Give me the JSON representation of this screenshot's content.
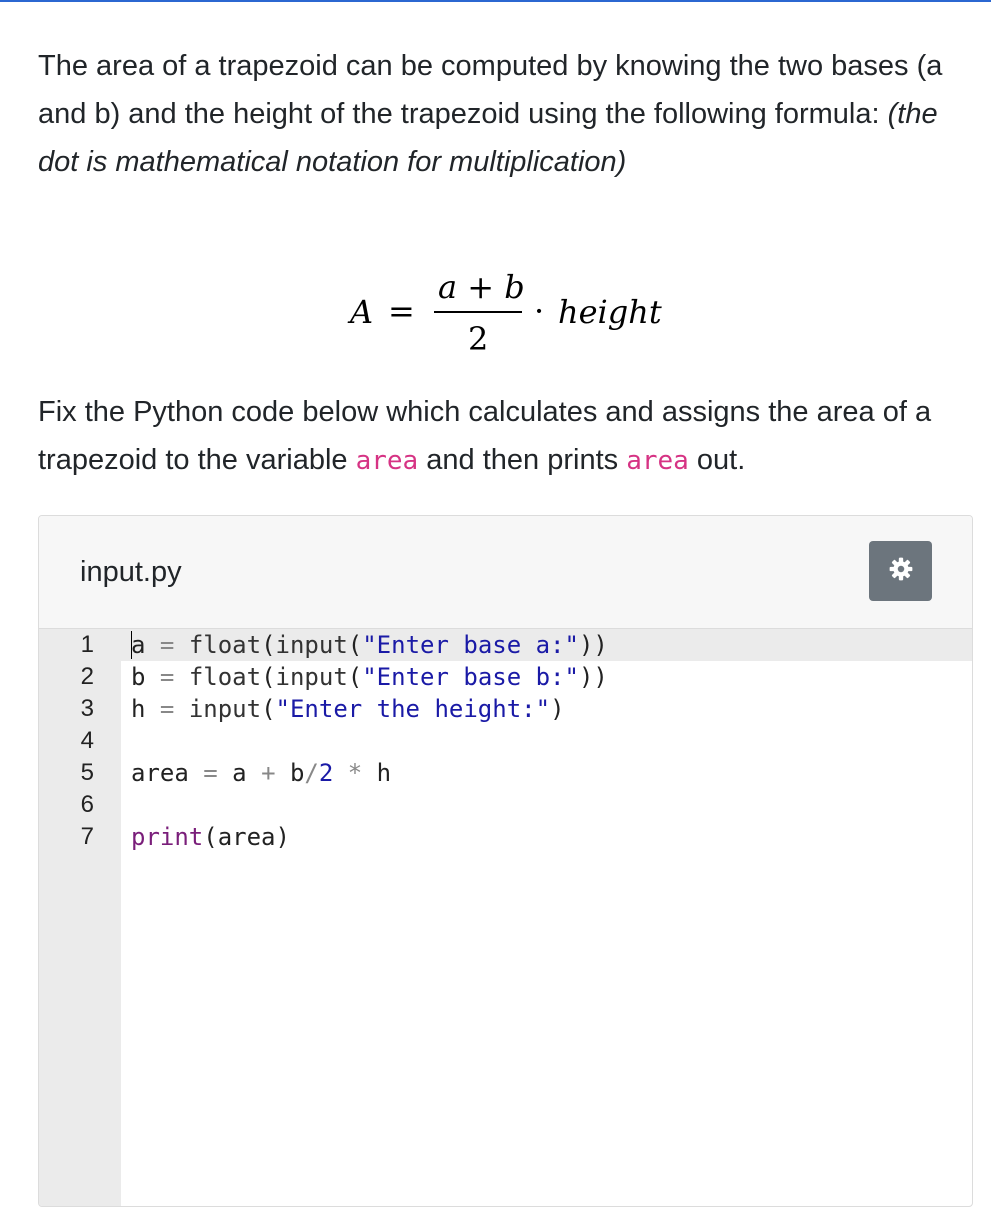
{
  "intro": {
    "text": "The area of a trapezoid can be computed by knowing the two bases (a and b) and the height of the trapezoid using the following formula: ",
    "emphasis": "(the dot is mathematical notation for multiplication)"
  },
  "formula": {
    "lhs": "A",
    "equals": "=",
    "numerator": "a + b",
    "denominator": "2",
    "operator": "·",
    "term": "height"
  },
  "instructions": {
    "part1": "Fix the Python code below which calculates and assigns the area of a trapezoid to the variable ",
    "var1": "area",
    "part2": " and then prints ",
    "var2": "area",
    "part3": " out."
  },
  "editor": {
    "filename": "input.py",
    "settings_icon": "gear-icon",
    "line_numbers": [
      "1",
      "2",
      "3",
      "4",
      "5",
      "6",
      "7"
    ],
    "lines": [
      "a = float(input(\"Enter base a:\"))",
      "b = float(input(\"Enter base b:\"))",
      "h = input(\"Enter the height:\")",
      "",
      "area = a + b/2 * h",
      "",
      "print(area)"
    ],
    "active_line": "1"
  },
  "colors": {
    "inline_code": "#d63384",
    "string": "#1a1aa6",
    "settings_button": "#6c757d"
  }
}
